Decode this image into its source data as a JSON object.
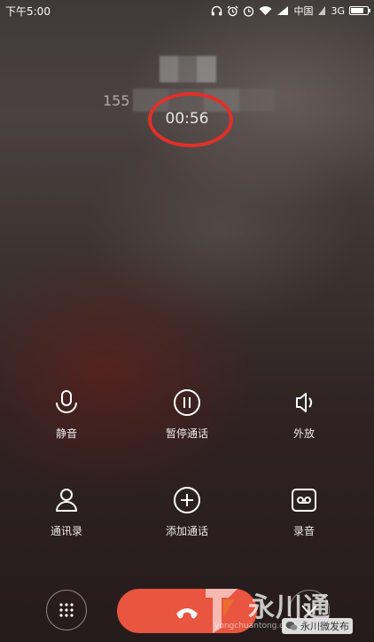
{
  "status_bar": {
    "time": "下午5:00",
    "carrier": "中国",
    "network": "3G",
    "battery_level": 0.8
  },
  "call": {
    "number_prefix": "155",
    "timer": "00:56"
  },
  "controls": {
    "mute_label": "静音",
    "hold_label": "暂停通话",
    "speaker_label": "外放",
    "contacts_label": "通讯录",
    "add_call_label": "添加通话",
    "record_label": "录音"
  },
  "watermark": {
    "brand": "永川通",
    "url": "yongchuantong.com",
    "wechat_account": "永川微发布"
  },
  "colors": {
    "end_call": "#e9553f",
    "annotation": "#e0302a"
  },
  "icons": [
    "headphones-icon",
    "alarm-icon",
    "clock-icon",
    "wifi-icon",
    "signal-icon",
    "microphone-icon",
    "pause-icon",
    "speaker-icon",
    "contact-icon",
    "plus-icon",
    "record-icon",
    "dialpad-icon",
    "hangup-icon",
    "chevron-down-icon",
    "wechat-icon"
  ]
}
